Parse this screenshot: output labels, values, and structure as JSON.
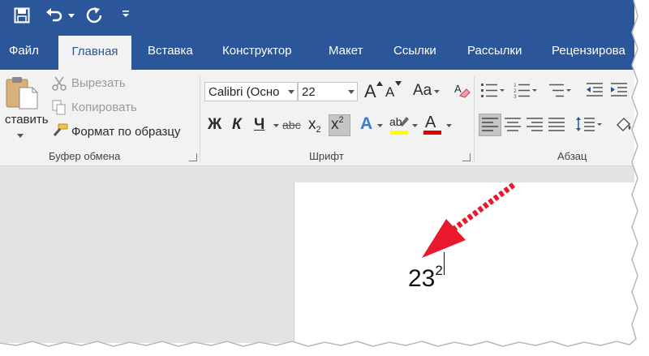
{
  "tabs": {
    "file": "Файл",
    "home": "Главная",
    "insert": "Вставка",
    "design": "Конструктор",
    "layout": "Макет",
    "references": "Ссылки",
    "mailings": "Рассылки",
    "review": "Рецензирова"
  },
  "clipboard": {
    "paste": "ставить",
    "cut": "Вырезать",
    "copy": "Копировать",
    "format_painter": "Формат по образцу",
    "group_label": "Буфер обмена"
  },
  "font": {
    "name": "Calibri (Осно",
    "size": "22",
    "case_label": "Aa",
    "bold": "Ж",
    "italic": "К",
    "underline": "Ч",
    "strike": "abc",
    "subscript": "x",
    "subscript_mark": "2",
    "superscript": "x",
    "superscript_mark": "2",
    "grow": "A",
    "shrink": "A",
    "text_effects": "A",
    "font_color": "A",
    "highlight": "ab",
    "group_label": "Шрифт"
  },
  "paragraph": {
    "group_label": "Абзац"
  },
  "document": {
    "base_text": "23",
    "superscript_text": "2"
  },
  "colors": {
    "ribbon_blue": "#2b579a",
    "highlight_yellow": "#ffff00",
    "font_red": "#e00000",
    "arrow_red": "#e8192c"
  }
}
